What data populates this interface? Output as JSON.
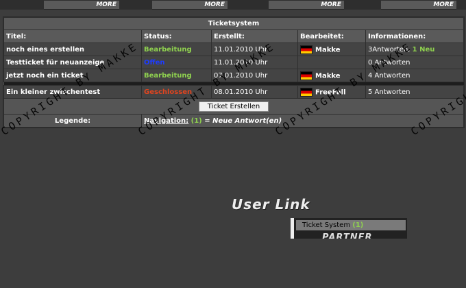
{
  "topnav": {
    "more_label": "MORE"
  },
  "tickets": {
    "title": "Ticketsystem",
    "headers": [
      "Titel:",
      "Status:",
      "Erstellt:",
      "Bearbeitet:",
      "Informationen:"
    ],
    "rows": [
      {
        "title": "noch eines erstellen",
        "status": "Bearbeitung",
        "status_color": "#8fd14f",
        "created": "11.01.2010 Uhr",
        "editor": "Makke",
        "info": "3Antworten,",
        "info_new": "1 Neu"
      },
      {
        "title": "Testticket für neuanzeige",
        "status": "Offen",
        "status_color": "#1e3cff",
        "created": "11.01.2010 Uhr",
        "editor": "",
        "info": "0 Antworten",
        "info_new": ""
      },
      {
        "title": "jetzt noch ein ticket",
        "status": "Bearbeitung",
        "status_color": "#8fd14f",
        "created": "07.01.2010 Uhr",
        "editor": "Makke",
        "info": "4 Antworten",
        "info_new": ""
      },
      {
        "title": "Ein kleiner zwischentest",
        "status": "Geschlossen",
        "status_color": "#e0441f",
        "created": "08.01.2010 Uhr",
        "editor": "FreeFall",
        "info": "5 Antworten",
        "info_new": ""
      }
    ],
    "create_button": "Ticket Erstellen",
    "legend_label": "Legende:",
    "legend_nav": "Navigation:",
    "legend_count": "(1)",
    "legend_text": "= Neue Antwort(en)"
  },
  "watermark": "COPYRIGHT BY MAKKE",
  "userlink": {
    "title": "User Link",
    "item": "Ticket System",
    "item_count": "(1)",
    "partner": "PARTNER"
  }
}
